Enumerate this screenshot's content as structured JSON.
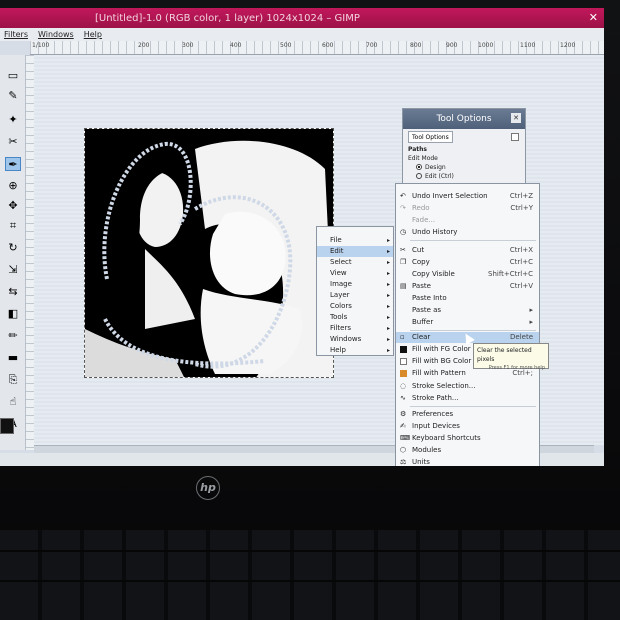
{
  "window": {
    "title": "[Untitled]-1.0 (RGB color, 1 layer) 1024x1024 – GIMP"
  },
  "menubar": [
    "Filters",
    "Windows",
    "Help"
  ],
  "ruler_ticks": [
    "1/100",
    "200",
    "300",
    "400",
    "500",
    "600",
    "700",
    "800",
    "900",
    "1000",
    "1100",
    "1200"
  ],
  "tool_options": {
    "title": "Tool Options",
    "tab": "Tool Options",
    "section": "Paths",
    "edit_mode_label": "Edit Mode",
    "modes": [
      "Design",
      "Edit (Ctrl)"
    ]
  },
  "image_menu": {
    "items": [
      "File",
      "Edit",
      "Select",
      "View",
      "Image",
      "Layer",
      "Colors",
      "Tools",
      "Filters",
      "Windows",
      "Help"
    ],
    "selected": "Edit"
  },
  "edit_menu": {
    "items": [
      {
        "label": "Undo Invert Selection",
        "shortcut": "Ctrl+Z",
        "icon": "undo-icon"
      },
      {
        "label": "Redo",
        "shortcut": "Ctrl+Y",
        "icon": "redo-icon",
        "dim": true
      },
      {
        "label": "Fade...",
        "shortcut": "",
        "icon": "",
        "dim": true
      },
      {
        "label": "Undo History",
        "shortcut": "",
        "icon": "history-icon"
      },
      {
        "label": "Cut",
        "shortcut": "Ctrl+X",
        "icon": "cut-icon"
      },
      {
        "label": "Copy",
        "shortcut": "Ctrl+C",
        "icon": "copy-icon"
      },
      {
        "label": "Copy Visible",
        "shortcut": "Shift+Ctrl+C",
        "icon": ""
      },
      {
        "label": "Paste",
        "shortcut": "Ctrl+V",
        "icon": "paste-icon"
      },
      {
        "label": "Paste Into",
        "shortcut": "",
        "icon": ""
      },
      {
        "label": "Paste as",
        "shortcut": "",
        "icon": ""
      },
      {
        "label": "Buffer",
        "shortcut": "",
        "icon": ""
      },
      {
        "label": "Clear",
        "shortcut": "Delete",
        "icon": "clear-icon",
        "selected": true
      },
      {
        "label": "Fill with FG Color",
        "shortcut": "",
        "icon": "fg-fill-icon"
      },
      {
        "label": "Fill with BG Color",
        "shortcut": "",
        "icon": "bg-fill-icon"
      },
      {
        "label": "Fill with Pattern",
        "shortcut": "Ctrl+;",
        "icon": "pattern-fill-icon"
      },
      {
        "label": "Stroke Selection...",
        "shortcut": "",
        "icon": "stroke-icon"
      },
      {
        "label": "Stroke Path...",
        "shortcut": "",
        "icon": "stroke-path-icon"
      },
      {
        "label": "Preferences",
        "shortcut": "",
        "icon": "preferences-icon"
      },
      {
        "label": "Input Devices",
        "shortcut": "",
        "icon": "input-devices-icon"
      },
      {
        "label": "Keyboard Shortcuts",
        "shortcut": "",
        "icon": "keyboard-icon"
      },
      {
        "label": "Modules",
        "shortcut": "",
        "icon": "modules-icon"
      },
      {
        "label": "Units",
        "shortcut": "",
        "icon": "units-icon"
      }
    ]
  },
  "tooltip": {
    "text": "Clear the selected pixels",
    "hint": "Press F1 for more help"
  },
  "laptop": {
    "brand": "hp"
  }
}
